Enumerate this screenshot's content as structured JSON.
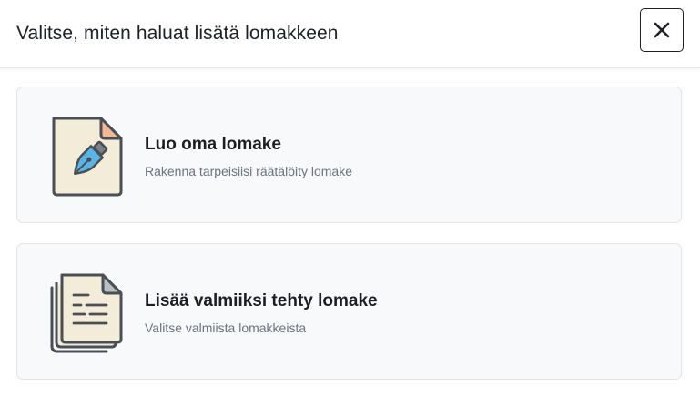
{
  "dialog": {
    "title": "Valitse, miten haluat lisätä lomakkeen",
    "close_icon": "close-icon"
  },
  "options": [
    {
      "title": "Luo oma lomake",
      "description": "Rakenna tarpeisiisi räätälöity lomake",
      "icon": "pen-document-icon"
    },
    {
      "title": "Lisää valmiiksi tehty lomake",
      "description": "Valitse valmiista lomakkeista",
      "icon": "stacked-documents-icon"
    }
  ],
  "colors": {
    "paper": "#f3ecd9",
    "outline": "#4a4f55",
    "fold": "#f4b896",
    "fold_gray": "#b9bec5",
    "pen_blue": "#5ab4e6",
    "card_bg": "#f8f9fb"
  }
}
